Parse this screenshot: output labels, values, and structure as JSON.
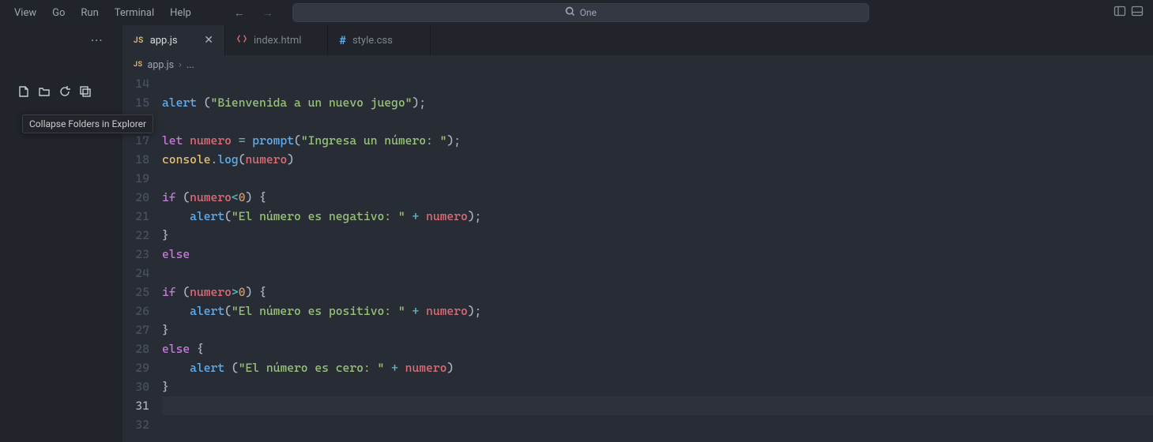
{
  "menubar": {
    "items": [
      "View",
      "Go",
      "Run",
      "Terminal",
      "Help"
    ]
  },
  "commandCenter": {
    "text": "One"
  },
  "tabs": [
    {
      "icon": "js",
      "label": "app.js",
      "active": true,
      "close": true
    },
    {
      "icon": "html",
      "label": "index.html",
      "active": false,
      "close": false
    },
    {
      "icon": "css",
      "label": "style.css",
      "active": false,
      "close": false
    }
  ],
  "breadcrumb": {
    "icon": "js",
    "file": "app.js",
    "tail": "..."
  },
  "tooltip": "Collapse Folders in Explorer",
  "code": {
    "startLine": 14,
    "currentLine": 31,
    "lines": [
      {
        "n": 14,
        "tokens": []
      },
      {
        "n": 15,
        "tokens": [
          {
            "c": "tk-fn",
            "t": "alert"
          },
          {
            "c": "tk-punc",
            "t": " ("
          },
          {
            "c": "tk-str",
            "t": "\"Bienvenida a un nuevo juego\""
          },
          {
            "c": "tk-punc",
            "t": ");"
          }
        ]
      },
      {
        "n": 16,
        "tokens": []
      },
      {
        "n": 17,
        "tokens": [
          {
            "c": "tk-kw",
            "t": "let"
          },
          {
            "c": "tk-plain",
            "t": " "
          },
          {
            "c": "tk-var",
            "t": "numero"
          },
          {
            "c": "tk-plain",
            "t": " "
          },
          {
            "c": "tk-op",
            "t": "="
          },
          {
            "c": "tk-plain",
            "t": " "
          },
          {
            "c": "tk-fn",
            "t": "prompt"
          },
          {
            "c": "tk-punc",
            "t": "("
          },
          {
            "c": "tk-str",
            "t": "\"Ingresa un número: \""
          },
          {
            "c": "tk-punc",
            "t": ");"
          }
        ]
      },
      {
        "n": 18,
        "tokens": [
          {
            "c": "tk-obj",
            "t": "console"
          },
          {
            "c": "tk-punc",
            "t": "."
          },
          {
            "c": "tk-fn",
            "t": "log"
          },
          {
            "c": "tk-punc",
            "t": "("
          },
          {
            "c": "tk-var",
            "t": "numero"
          },
          {
            "c": "tk-punc",
            "t": ")"
          }
        ]
      },
      {
        "n": 19,
        "tokens": []
      },
      {
        "n": 20,
        "tokens": [
          {
            "c": "tk-kw",
            "t": "if"
          },
          {
            "c": "tk-plain",
            "t": " "
          },
          {
            "c": "tk-punc",
            "t": "("
          },
          {
            "c": "tk-var",
            "t": "numero"
          },
          {
            "c": "tk-op",
            "t": "<"
          },
          {
            "c": "tk-num",
            "t": "0"
          },
          {
            "c": "tk-punc",
            "t": ") {"
          }
        ]
      },
      {
        "n": 21,
        "tokens": [
          {
            "c": "tk-plain",
            "t": "    "
          },
          {
            "c": "tk-fn",
            "t": "alert"
          },
          {
            "c": "tk-punc",
            "t": "("
          },
          {
            "c": "tk-str",
            "t": "\"El número es negativo: \""
          },
          {
            "c": "tk-plain",
            "t": " "
          },
          {
            "c": "tk-op",
            "t": "+"
          },
          {
            "c": "tk-plain",
            "t": " "
          },
          {
            "c": "tk-var",
            "t": "numero"
          },
          {
            "c": "tk-punc",
            "t": ");"
          }
        ]
      },
      {
        "n": 22,
        "tokens": [
          {
            "c": "tk-punc",
            "t": "}"
          }
        ]
      },
      {
        "n": 23,
        "tokens": [
          {
            "c": "tk-kw",
            "t": "else"
          }
        ]
      },
      {
        "n": 24,
        "tokens": []
      },
      {
        "n": 25,
        "tokens": [
          {
            "c": "tk-kw",
            "t": "if"
          },
          {
            "c": "tk-plain",
            "t": " "
          },
          {
            "c": "tk-punc",
            "t": "("
          },
          {
            "c": "tk-var",
            "t": "numero"
          },
          {
            "c": "tk-op",
            "t": ">"
          },
          {
            "c": "tk-num",
            "t": "0"
          },
          {
            "c": "tk-punc",
            "t": ") {"
          }
        ]
      },
      {
        "n": 26,
        "tokens": [
          {
            "c": "tk-plain",
            "t": "    "
          },
          {
            "c": "tk-fn",
            "t": "alert"
          },
          {
            "c": "tk-punc",
            "t": "("
          },
          {
            "c": "tk-str",
            "t": "\"El número es positivo: \""
          },
          {
            "c": "tk-plain",
            "t": " "
          },
          {
            "c": "tk-op",
            "t": "+"
          },
          {
            "c": "tk-plain",
            "t": " "
          },
          {
            "c": "tk-var",
            "t": "numero"
          },
          {
            "c": "tk-punc",
            "t": ");"
          }
        ]
      },
      {
        "n": 27,
        "tokens": [
          {
            "c": "tk-punc",
            "t": "}"
          }
        ]
      },
      {
        "n": 28,
        "tokens": [
          {
            "c": "tk-kw",
            "t": "else"
          },
          {
            "c": "tk-plain",
            "t": " "
          },
          {
            "c": "tk-punc",
            "t": "{"
          }
        ]
      },
      {
        "n": 29,
        "tokens": [
          {
            "c": "tk-plain",
            "t": "    "
          },
          {
            "c": "tk-fn",
            "t": "alert"
          },
          {
            "c": "tk-plain",
            "t": " "
          },
          {
            "c": "tk-punc",
            "t": "("
          },
          {
            "c": "tk-str",
            "t": "\"El número es cero: \""
          },
          {
            "c": "tk-plain",
            "t": " "
          },
          {
            "c": "tk-op",
            "t": "+"
          },
          {
            "c": "tk-plain",
            "t": " "
          },
          {
            "c": "tk-var",
            "t": "numero"
          },
          {
            "c": "tk-punc",
            "t": ")"
          }
        ]
      },
      {
        "n": 30,
        "tokens": [
          {
            "c": "tk-punc",
            "t": "}"
          }
        ]
      },
      {
        "n": 31,
        "tokens": []
      },
      {
        "n": 32,
        "tokens": []
      }
    ]
  }
}
